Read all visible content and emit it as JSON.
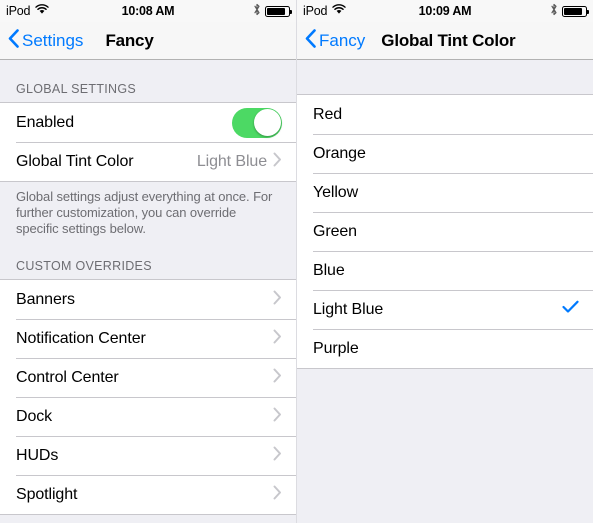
{
  "left_panel": {
    "status_bar": {
      "carrier": "iPod",
      "wifi_icon": "wifi-icon",
      "time": "10:08 AM",
      "bluetooth_icon": "bluetooth-icon",
      "battery_icon": "battery-icon"
    },
    "nav": {
      "back_label": "Settings",
      "back_icon": "chevron-left-icon",
      "title": "Fancy"
    },
    "sections": [
      {
        "header": "GLOBAL SETTINGS",
        "rows": [
          {
            "label": "Enabled",
            "control": "toggle",
            "toggle_on": true
          },
          {
            "label": "Global Tint Color",
            "value": "Light Blue",
            "control": "chevron"
          }
        ],
        "footer": "Global settings adjust everything at once. For further customization, you can override specific settings below."
      },
      {
        "header": "CUSTOM OVERRIDES",
        "rows": [
          {
            "label": "Banners",
            "control": "chevron"
          },
          {
            "label": "Notification Center",
            "control": "chevron"
          },
          {
            "label": "Control Center",
            "control": "chevron"
          },
          {
            "label": "Dock",
            "control": "chevron"
          },
          {
            "label": "HUDs",
            "control": "chevron"
          },
          {
            "label": "Spotlight",
            "control": "chevron"
          }
        ]
      }
    ]
  },
  "right_panel": {
    "status_bar": {
      "carrier": "iPod",
      "wifi_icon": "wifi-icon",
      "time": "10:09 AM",
      "bluetooth_icon": "bluetooth-icon",
      "battery_icon": "battery-icon"
    },
    "nav": {
      "back_label": "Fancy",
      "back_icon": "chevron-left-icon",
      "title": "Global Tint Color"
    },
    "options": [
      {
        "label": "Red",
        "selected": false
      },
      {
        "label": "Orange",
        "selected": false
      },
      {
        "label": "Yellow",
        "selected": false
      },
      {
        "label": "Green",
        "selected": false
      },
      {
        "label": "Blue",
        "selected": false
      },
      {
        "label": "Light Blue",
        "selected": true
      },
      {
        "label": "Purple",
        "selected": false
      }
    ],
    "checkmark_icon": "checkmark-icon"
  },
  "colors": {
    "tint": "#007aff",
    "toggle_on": "#4cd964",
    "group_bg": "#ffffff",
    "table_bg": "#efeff4",
    "separator": "#c8c7cc",
    "secondary_text": "#8e8e93",
    "header_text": "#6d6d72"
  }
}
